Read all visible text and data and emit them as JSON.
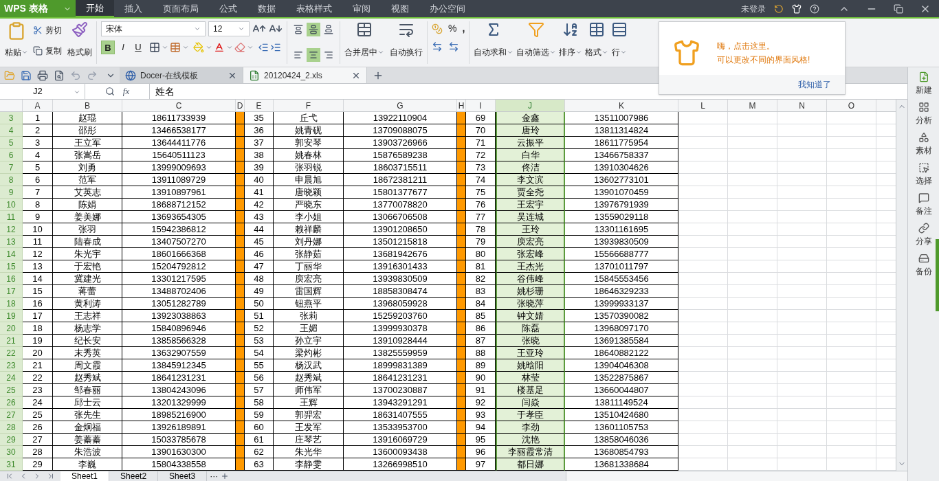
{
  "app": {
    "name": "WPS 表格"
  },
  "menu_tabs": [
    {
      "label": "开始",
      "selected": true
    },
    {
      "label": "插入",
      "selected": false
    },
    {
      "label": "页面布局",
      "selected": false
    },
    {
      "label": "公式",
      "selected": false
    },
    {
      "label": "数据",
      "selected": false
    },
    {
      "label": "表格样式",
      "selected": false
    },
    {
      "label": "审阅",
      "selected": false
    },
    {
      "label": "视图",
      "selected": false
    },
    {
      "label": "办公空间",
      "selected": false
    }
  ],
  "login_status": "未登录",
  "ribbon": {
    "paste": "粘贴",
    "cut": "剪切",
    "copy": "复制",
    "format_painter": "格式刷",
    "font_name": "宋体",
    "font_size": "12",
    "font_buttons": [
      {
        "label": "B",
        "active": true
      },
      {
        "label": "I",
        "active": false
      },
      {
        "label": "U",
        "active": false
      }
    ],
    "align_buttons": [
      {
        "kind": "top",
        "active": false
      },
      {
        "kind": "middle",
        "active": true
      },
      {
        "kind": "bottom",
        "active": false
      },
      {
        "kind": "left",
        "active": false
      },
      {
        "kind": "center",
        "active": true
      },
      {
        "kind": "right",
        "active": false
      }
    ],
    "merge": "合并居中",
    "wrap": "自动换行",
    "percent": "%",
    "comma": ",",
    "tools": [
      {
        "kind": "sum",
        "label": "自动求和"
      },
      {
        "kind": "filter",
        "label": "自动筛选"
      },
      {
        "kind": "sort",
        "label": "排序"
      },
      {
        "kind": "format",
        "label": "格式"
      },
      {
        "kind": "rows",
        "label": "行"
      }
    ]
  },
  "doc_tabs": [
    {
      "kind": "web",
      "label": "Docer-在线模板",
      "selected": false
    },
    {
      "kind": "sheet",
      "label": "20120424_2.xls",
      "selected": true
    }
  ],
  "formula_bar": {
    "cell": "J2",
    "function_label": "fx",
    "value": "姓名"
  },
  "columns": [
    {
      "label": "A",
      "selected": false
    },
    {
      "label": "B",
      "selected": false
    },
    {
      "label": "C",
      "selected": false
    },
    {
      "label": "D",
      "selected": false,
      "color": "#ff9900"
    },
    {
      "label": "E",
      "selected": false
    },
    {
      "label": "F",
      "selected": false
    },
    {
      "label": "G",
      "selected": false
    },
    {
      "label": "H",
      "selected": false,
      "color": "#ff9900"
    },
    {
      "label": "I",
      "selected": false
    },
    {
      "label": "J",
      "selected": true
    },
    {
      "label": "K",
      "selected": false
    },
    {
      "label": "L",
      "selected": false
    },
    {
      "label": "M",
      "selected": false
    },
    {
      "label": "N",
      "selected": false
    },
    {
      "label": "O",
      "selected": false
    }
  ],
  "rows": [
    {
      "row": "3",
      "cells": [
        "1",
        "赵琨",
        "18611733939",
        null,
        "35",
        "丘弋",
        "13922110904",
        null,
        "69",
        "金鑫",
        "13511007986"
      ]
    },
    {
      "row": "4",
      "cells": [
        "2",
        "邵彤",
        "13466538177",
        null,
        "36",
        "姚青砚",
        "13709088075",
        null,
        "70",
        "唐玲",
        "13811314824"
      ]
    },
    {
      "row": "5",
      "cells": [
        "3",
        "王立军",
        "13644411776",
        null,
        "37",
        "郭安琴",
        "13903726966",
        null,
        "71",
        "云振平",
        "18611775954"
      ]
    },
    {
      "row": "6",
      "cells": [
        "4",
        "张嵩岳",
        "15640511123",
        null,
        "38",
        "姚春林",
        "15876589238",
        null,
        "72",
        "白华",
        "13466758337"
      ]
    },
    {
      "row": "7",
      "cells": [
        "5",
        "刘勇",
        "13999009693",
        null,
        "39",
        "张羽锐",
        "18603715511",
        null,
        "73",
        "佟洁",
        "13910304626"
      ]
    },
    {
      "row": "8",
      "cells": [
        "6",
        "范军",
        "13911089729",
        null,
        "40",
        "申晨旭",
        "18672381211",
        null,
        "74",
        "李文滨",
        "13602773101"
      ]
    },
    {
      "row": "9",
      "cells": [
        "7",
        "艾英志",
        "13910897961",
        null,
        "41",
        "唐晓颖",
        "15801377677",
        null,
        "75",
        "贾全尧",
        "13901070459"
      ]
    },
    {
      "row": "10",
      "cells": [
        "8",
        "陈娟",
        "18688712152",
        null,
        "42",
        "严晓东",
        "13770078820",
        null,
        "76",
        "王宏宇",
        "13976791939"
      ]
    },
    {
      "row": "11",
      "cells": [
        "9",
        "姜美娜",
        "13693654305",
        null,
        "43",
        "李小姐",
        "13066706508",
        null,
        "77",
        "吴连城",
        "13559029118"
      ]
    },
    {
      "row": "12",
      "cells": [
        "10",
        "张羽",
        "15942386812",
        null,
        "44",
        "赖祥麟",
        "13901208650",
        null,
        "78",
        "王玲",
        "13301161695"
      ]
    },
    {
      "row": "13",
      "cells": [
        "11",
        "陆春成",
        "13407507270",
        null,
        "45",
        "刘丹娜",
        "13501215818",
        null,
        "79",
        "庾宏亮",
        "13939830509"
      ]
    },
    {
      "row": "14",
      "cells": [
        "12",
        "朱光宇",
        "18601666368",
        null,
        "46",
        "张静茹",
        "13681942676",
        null,
        "80",
        "张宏峰",
        "15566688777"
      ]
    },
    {
      "row": "15",
      "cells": [
        "13",
        "于宏艳",
        "15204792812",
        null,
        "47",
        "丁丽华",
        "13916301433",
        null,
        "81",
        "王杰光",
        "13701011797"
      ]
    },
    {
      "row": "16",
      "cells": [
        "14",
        "冀建光",
        "13301217595",
        null,
        "48",
        "庾宏亮",
        "13939830509",
        null,
        "82",
        "谷伟峰",
        "15845553456"
      ]
    },
    {
      "row": "17",
      "cells": [
        "15",
        "蒋蕾",
        "13488702406",
        null,
        "49",
        "雷国辉",
        "18858308474",
        null,
        "83",
        "姚杉珊",
        "18646329233"
      ]
    },
    {
      "row": "18",
      "cells": [
        "16",
        "黄利涛",
        "13051282789",
        null,
        "50",
        "钮燕平",
        "13968059928",
        null,
        "84",
        "张晓萍",
        "13999933137"
      ]
    },
    {
      "row": "19",
      "cells": [
        "17",
        "王志祥",
        "13923038863",
        null,
        "51",
        "张莉",
        "15259203760",
        null,
        "85",
        "钟文婧",
        "13570390082"
      ]
    },
    {
      "row": "20",
      "cells": [
        "18",
        "杨志学",
        "15840896946",
        null,
        "52",
        "王媚",
        "13999930378",
        null,
        "86",
        "陈磊",
        "13968097170"
      ]
    },
    {
      "row": "21",
      "cells": [
        "19",
        "纪长安",
        "13858566328",
        null,
        "53",
        "孙立宇",
        "13910928444",
        null,
        "87",
        "张晓",
        "13691385584"
      ]
    },
    {
      "row": "22",
      "cells": [
        "20",
        "末秀英",
        "13632907559",
        null,
        "54",
        "梁灼彬",
        "13825559959",
        null,
        "88",
        "王亚玲",
        "18640882122"
      ]
    },
    {
      "row": "23",
      "cells": [
        "21",
        "周文霞",
        "13845912345",
        null,
        "55",
        "杨汉武",
        "18999831389",
        null,
        "89",
        "姚晗阳",
        "13904046308"
      ]
    },
    {
      "row": "24",
      "cells": [
        "22",
        "赵秀斌",
        "18641231231",
        null,
        "56",
        "赵秀斌",
        "18641231231",
        null,
        "90",
        "林莹",
        "13522875867"
      ]
    },
    {
      "row": "25",
      "cells": [
        "23",
        "邹春丽",
        "13804243096",
        null,
        "57",
        "师伟军",
        "13700230887",
        null,
        "91",
        "楼基足",
        "13660044807"
      ]
    },
    {
      "row": "26",
      "cells": [
        "24",
        "邱士云",
        "13201329999",
        null,
        "58",
        "王辉",
        "13943291291",
        null,
        "92",
        "闫焱",
        "13811149524"
      ]
    },
    {
      "row": "27",
      "cells": [
        "25",
        "张先生",
        "18985216900",
        null,
        "59",
        "郭羿宏",
        "18631407555",
        null,
        "93",
        "于孝臣",
        "13510424680"
      ]
    },
    {
      "row": "28",
      "cells": [
        "26",
        "金炯福",
        "13926189891",
        null,
        "60",
        "王发军",
        "13533953700",
        null,
        "94",
        "李劲",
        "13601105753"
      ]
    },
    {
      "row": "29",
      "cells": [
        "27",
        "姜蓁蓁",
        "15033785678",
        null,
        "61",
        "庄琴艺",
        "13916069729",
        null,
        "95",
        "沈艳",
        "13858046036"
      ]
    },
    {
      "row": "30",
      "cells": [
        "28",
        "朱浩波",
        "13901630300",
        null,
        "62",
        "朱光华",
        "13600093438",
        null,
        "96",
        "李丽霞常清",
        "13680854793"
      ]
    },
    {
      "row": "31",
      "cells": [
        "29",
        "李巍",
        "15804338558",
        null,
        "63",
        "李静雯",
        "13266998510",
        null,
        "97",
        "都日娜",
        "13681338684"
      ]
    }
  ],
  "sheet_tabs": [
    {
      "label": "Sheet1",
      "selected": true
    },
    {
      "label": "Sheet2",
      "selected": false
    },
    {
      "label": "Sheet3",
      "selected": false
    }
  ],
  "sheet_more": "···",
  "side_panel": [
    {
      "kind": "new",
      "label": "新建"
    },
    {
      "kind": "analyze",
      "label": "分析"
    },
    {
      "kind": "assets",
      "label": "素材"
    },
    {
      "kind": "select",
      "label": "选择"
    },
    {
      "kind": "note",
      "label": "备注"
    },
    {
      "kind": "share",
      "label": "分享"
    },
    {
      "kind": "backup",
      "label": "备份"
    }
  ],
  "tip_popup": {
    "lines": [
      "嗨，点击这里。",
      "可以更改不同的界面风格!"
    ],
    "action": "我知道了"
  }
}
